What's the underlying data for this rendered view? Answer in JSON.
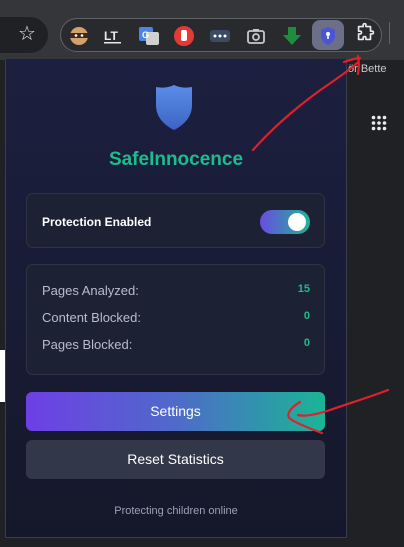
{
  "browser": {
    "bookmark_fragment": "ör Bette",
    "icons": {
      "star": "bookmark-star-icon",
      "puzzle": "extensions-puzzle-icon",
      "apps": "apps-grid-icon"
    },
    "extensions": [
      {
        "name": "extension-ninja-icon"
      },
      {
        "name": "extension-lt-icon",
        "text": "LT"
      },
      {
        "name": "extension-translate-icon",
        "text": "G"
      },
      {
        "name": "extension-stop-hand-icon"
      },
      {
        "name": "extension-dots-icon",
        "text": "•••"
      },
      {
        "name": "extension-camera-icon"
      },
      {
        "name": "extension-green-down-arrow-icon"
      },
      {
        "name": "extension-safeinnocence-shield-icon"
      }
    ]
  },
  "popup": {
    "brand": "SafeInnocence",
    "protection": {
      "label": "Protection Enabled",
      "enabled": true
    },
    "stats": [
      {
        "label": "Pages Analyzed:",
        "value": "15"
      },
      {
        "label": "Content Blocked:",
        "value": "0"
      },
      {
        "label": "Pages Blocked:",
        "value": "0"
      }
    ],
    "buttons": {
      "settings": "Settings",
      "reset": "Reset Statistics"
    },
    "footer": "Protecting children online"
  },
  "colors": {
    "accent_green": "#1ebc8b",
    "accent_purple": "#6e3fe6",
    "popup_bg": "#1a1d3a",
    "card_bg": "#1d2134",
    "annotation_red": "#e0202a"
  }
}
